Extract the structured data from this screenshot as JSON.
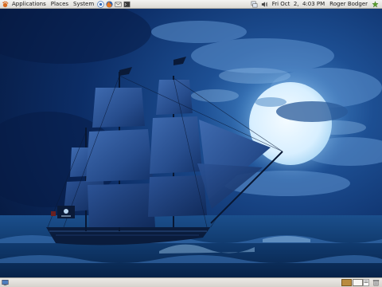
{
  "top_panel": {
    "menus": {
      "applications": "Applications",
      "places": "Places",
      "system": "System"
    },
    "launchers": [
      "help-icon",
      "firefox-icon",
      "mail-icon",
      "terminal-icon"
    ],
    "tray_icons": [
      "network-icon",
      "volume-icon"
    ],
    "clock": "Fri Oct  2,  4:03 PM",
    "user": "Roger Bodger",
    "status_icon": "update-notifier-icon"
  },
  "bottom_panel": {
    "show_desktop_icon": "show-desktop-icon",
    "workspace_count": 2,
    "active_workspace": 1,
    "trash_icon": "trash-icon"
  },
  "desktop": {
    "wallpaper": "pirate ship under full moon",
    "colors": {
      "sky_dark": "#061a44",
      "sky_mid": "#1a4a8a",
      "moon": "#dff3ff",
      "sea": "#0d3060"
    }
  }
}
